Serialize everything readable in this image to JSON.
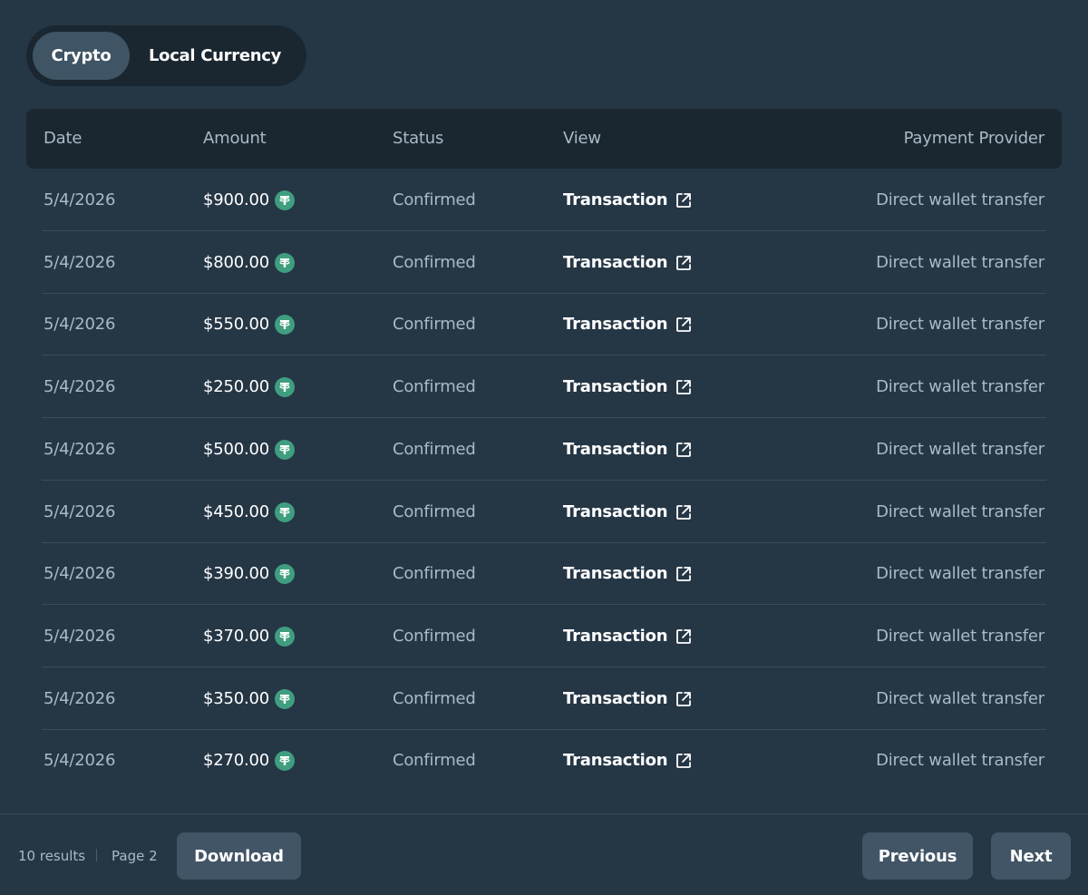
{
  "toggle": {
    "options": [
      {
        "label": "Crypto",
        "active": true
      },
      {
        "label": "Local Currency",
        "active": false
      }
    ]
  },
  "table": {
    "columns": {
      "date": "Date",
      "amount": "Amount",
      "status": "Status",
      "view": "View",
      "provider": "Payment Provider"
    },
    "rows": [
      {
        "date": "5/4/2026",
        "amount": "$900.00",
        "status": "Confirmed",
        "view": "Transaction",
        "provider": "Direct wallet transfer"
      },
      {
        "date": "5/4/2026",
        "amount": "$800.00",
        "status": "Confirmed",
        "view": "Transaction",
        "provider": "Direct wallet transfer"
      },
      {
        "date": "5/4/2026",
        "amount": "$550.00",
        "status": "Confirmed",
        "view": "Transaction",
        "provider": "Direct wallet transfer"
      },
      {
        "date": "5/4/2026",
        "amount": "$250.00",
        "status": "Confirmed",
        "view": "Transaction",
        "provider": "Direct wallet transfer"
      },
      {
        "date": "5/4/2026",
        "amount": "$500.00",
        "status": "Confirmed",
        "view": "Transaction",
        "provider": "Direct wallet transfer"
      },
      {
        "date": "5/4/2026",
        "amount": "$450.00",
        "status": "Confirmed",
        "view": "Transaction",
        "provider": "Direct wallet transfer"
      },
      {
        "date": "5/4/2026",
        "amount": "$390.00",
        "status": "Confirmed",
        "view": "Transaction",
        "provider": "Direct wallet transfer"
      },
      {
        "date": "5/4/2026",
        "amount": "$370.00",
        "status": "Confirmed",
        "view": "Transaction",
        "provider": "Direct wallet transfer"
      },
      {
        "date": "5/4/2026",
        "amount": "$350.00",
        "status": "Confirmed",
        "view": "Transaction",
        "provider": "Direct wallet transfer"
      },
      {
        "date": "5/4/2026",
        "amount": "$270.00",
        "status": "Confirmed",
        "view": "Transaction",
        "provider": "Direct wallet transfer"
      }
    ],
    "amount_icon": "tether-usdt-icon",
    "view_icon": "external-link-icon"
  },
  "footer": {
    "results": "10 results",
    "page": "Page 2",
    "download_label": "Download",
    "previous_label": "Previous",
    "next_label": "Next"
  },
  "colors": {
    "background": "#253645",
    "header_bg": "#1a2731",
    "button_bg": "#425566",
    "tether_green": "#3f9e7f"
  }
}
